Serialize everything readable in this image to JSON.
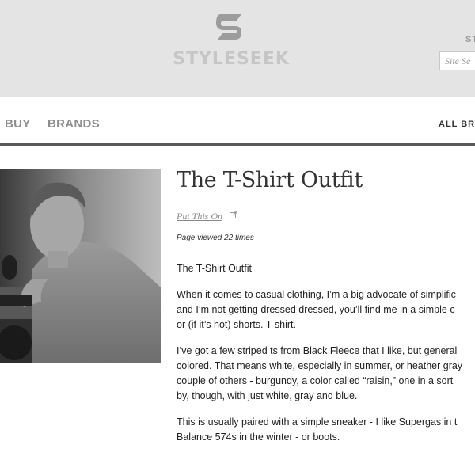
{
  "header": {
    "logo_text": "STYLESEEK",
    "top_link": "ST",
    "search_placeholder": "Site Se"
  },
  "nav": {
    "items": [
      {
        "label": "BUY"
      },
      {
        "label": "BRANDS"
      }
    ],
    "right_label": "ALL BRA"
  },
  "article": {
    "title": "The T-Shirt Outfit",
    "source_link": "Put This On",
    "page_views": "Page viewed 22 times",
    "paragraphs": [
      [
        "The T-Shirt Outfit"
      ],
      [
        "When it comes to casual clothing, I’m a big advocate of simplific",
        "and I’m not getting dressed dressed, you’ll find me in a simple c",
        "or (if it’s hot) shorts. T-shirt."
      ],
      [
        "I’ve got a few striped ts from Black Fleece that I like, but general",
        "colored. That means white, especially in summer, or heather gray",
        "couple of others - burgundy, a color called “raisin,” one in a sort",
        "by, though, with just white, gray and blue."
      ],
      [
        "This is usually paired with a simple sneaker - I like Supergas in t",
        "Balance 574s in the winter - or boots."
      ]
    ]
  },
  "photo": {
    "icon": "photo-man-on-motorcycle"
  },
  "colors": {
    "header_bg": "#e4e4e4",
    "nav_rule": "#5a5a5a",
    "nav_text": "#8e8e8e"
  }
}
